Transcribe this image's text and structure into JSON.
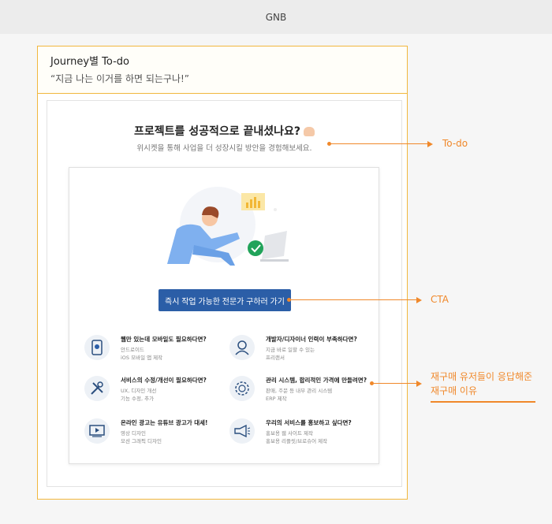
{
  "gnb": {
    "label": "GNB"
  },
  "journey": {
    "title": "Journey별 To-do",
    "quote": "“지금 나는 이거를 하면 되는구나!”"
  },
  "card": {
    "title": "프로젝트를 성공적으로 끝내셨나요?",
    "subtitle": "위시켓을 통해 사업을 더 성장시킬 방안을 경험해보세요.",
    "cta_label": "즉시 작업 가능한 전문가 구하러 가기"
  },
  "services": [
    {
      "title": "웹만 있는데 모바일도 필요하다면?",
      "line1": "안드로이드",
      "line2": "iOS 모바일 앱 제작",
      "icon": "mobile-icon"
    },
    {
      "title": "개발자/디자이너 인력이 부족하다면?",
      "line1": "지금 바로 일할 수 있는",
      "line2": "프리랜서",
      "icon": "person-icon"
    },
    {
      "title": "서비스의 수정/개선이 필요하다면?",
      "line1": "UX, 디자인 개선",
      "line2": "기능 수정, 추가",
      "icon": "tools-icon"
    },
    {
      "title": "관리 시스템, 합리적인 가격에 만들려면?",
      "line1": "판매, 주문 등 내부 관리 시스템",
      "line2": "ERP 제작",
      "icon": "erp-gear-icon"
    },
    {
      "title": "온라인 광고는 유튜브 광고가 대세!",
      "line1": "영상 디자인",
      "line2": "모션 그래픽 디자인",
      "icon": "video-icon"
    },
    {
      "title": "우리의 서비스를 홍보하고 싶다면?",
      "line1": "홍보용 웹 사이트 제작",
      "line2": "홍보용 리플릿/브로슈어 제작",
      "icon": "megaphone-icon"
    }
  ],
  "annotations": {
    "todo": "To-do",
    "cta": "CTA",
    "reason_line1": "재구매 유저들이 응답해준",
    "reason_line2": "재구매 이유"
  },
  "colors": {
    "accent": "#f0882a",
    "frame": "#f1b73e",
    "cta": "#2b5ea7"
  }
}
